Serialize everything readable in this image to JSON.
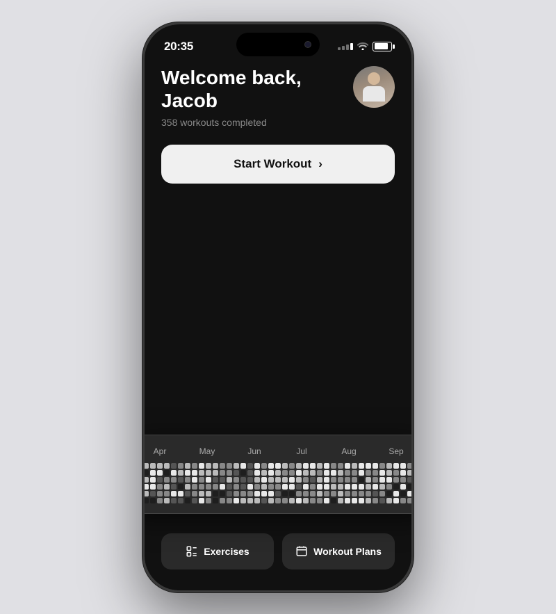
{
  "background_color": "#e0e0e4",
  "status_bar": {
    "time": "20:35",
    "signal_bars": 4,
    "wifi": true,
    "battery_percent": 85
  },
  "header": {
    "greeting": "Welcome back,",
    "user_name": "Jacob",
    "workout_count": "358 workouts completed"
  },
  "cta_button": {
    "label": "Start Workout",
    "chevron": "›"
  },
  "calendar": {
    "months": [
      "Apr",
      "May",
      "Jun",
      "Jul",
      "Aug",
      "Sep"
    ],
    "rows": 6,
    "cols": 52
  },
  "bottom_nav": {
    "exercises_label": "Exercises",
    "exercises_icon": "📋",
    "workout_plans_label": "Workout Plans",
    "workout_plans_icon": "📁"
  },
  "colors": {
    "phone_bg": "#111111",
    "card_bg": "#2a2a2a",
    "text_primary": "#ffffff",
    "text_secondary": "#888888",
    "button_bg": "#f0f0f0",
    "nav_btn_bg": "#2a2a2a"
  }
}
